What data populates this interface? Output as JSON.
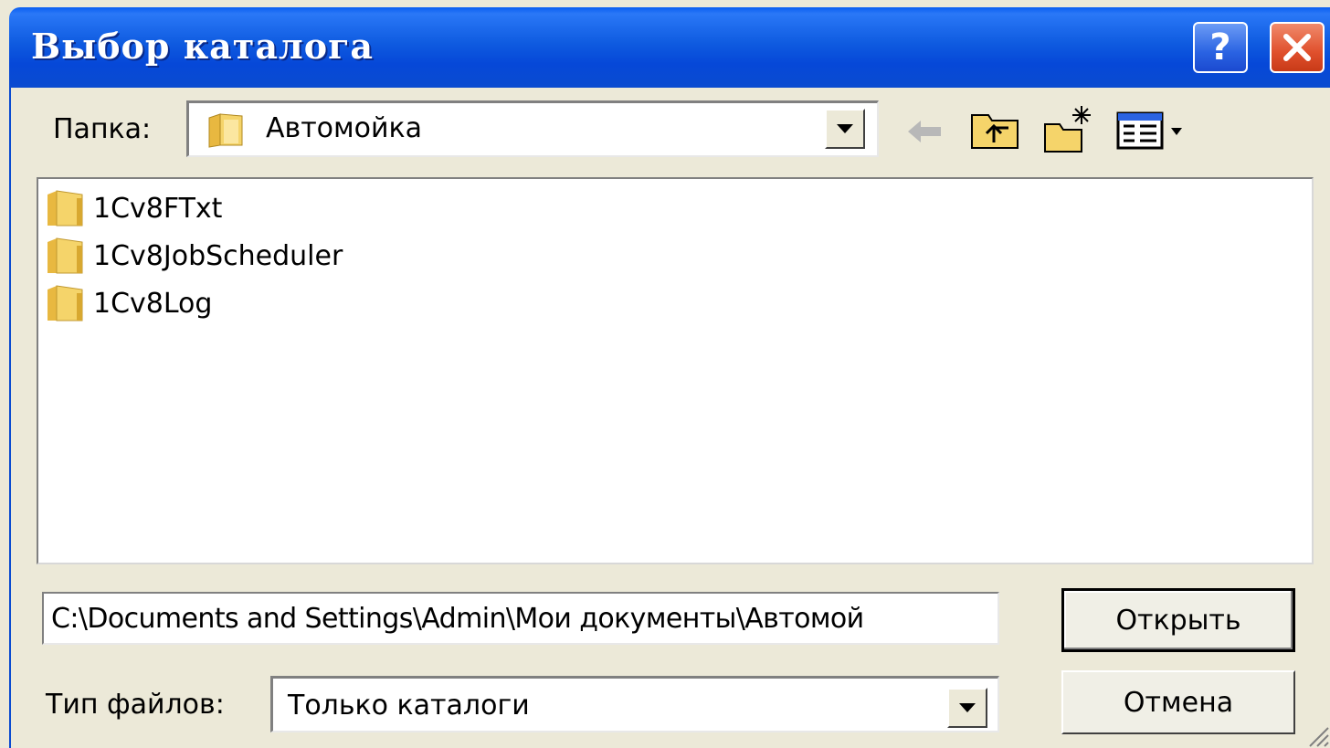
{
  "window": {
    "title": "Выбор каталога",
    "help_label": "?",
    "close_icon": "close-icon"
  },
  "toolbar": {
    "folder_label": "Папка:",
    "current_folder": "Автомойка",
    "back_icon": "back-arrow-icon",
    "up_icon": "up-one-level-icon",
    "new_folder_icon": "new-folder-icon",
    "view_menu_icon": "view-menu-icon"
  },
  "list": {
    "items": [
      {
        "label": "1Cv8FTxt",
        "icon": "folder-icon"
      },
      {
        "label": "1Cv8JobScheduler",
        "icon": "folder-icon"
      },
      {
        "label": "1Cv8Log",
        "icon": "folder-icon"
      }
    ]
  },
  "form": {
    "path_value": "C:\\Documents and Settings\\Admin\\Мои документы\\Автомой",
    "file_type_label": "Тип файлов:",
    "file_type_value": "Только каталоги"
  },
  "buttons": {
    "open_label": "Открыть",
    "cancel_label": "Отмена"
  },
  "colors": {
    "titlebar": "#0a4bd0",
    "dialog_bg": "#ece9d8",
    "close_button": "#e0502c",
    "help_button": "#2a63e2"
  }
}
